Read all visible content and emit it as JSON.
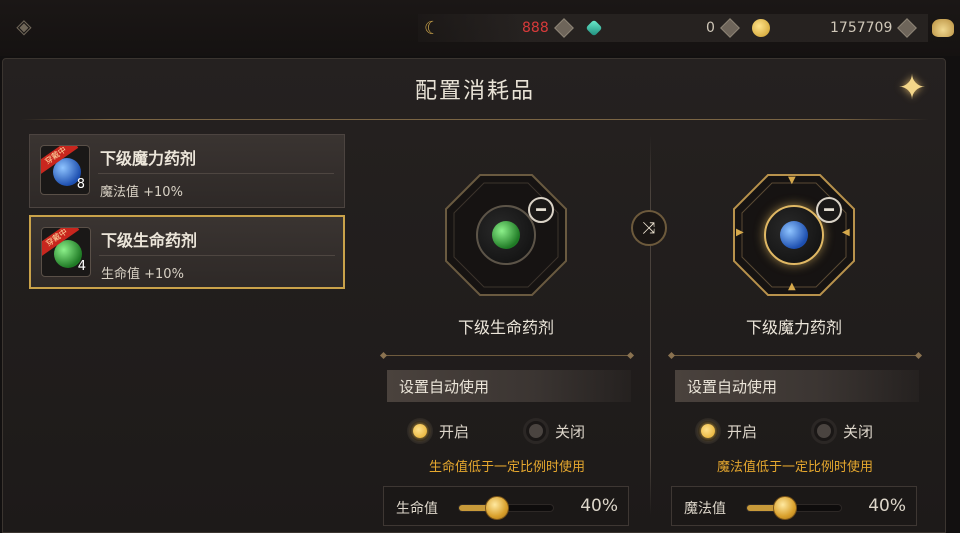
{
  "topbar": {
    "back_icon": "back-arrow-icon",
    "resources": [
      {
        "icon": "crescent-icon",
        "value": ""
      },
      {
        "icon": "red-gem-icon",
        "value": "888"
      },
      {
        "icon": "teal-crystal-icon",
        "value": "0"
      },
      {
        "icon": "gold-coin-icon",
        "value": "1757709"
      },
      {
        "icon": "bag-icon",
        "value": ""
      }
    ]
  },
  "panel": {
    "title": "配置消耗品",
    "close_icon": "close-star-icon"
  },
  "consumables": [
    {
      "name": "下级魔力药剂",
      "desc": "魔法值 +10%",
      "qty": "8",
      "badge": "穿戴中",
      "color": "#2f6fd6",
      "selected": false
    },
    {
      "name": "下级生命药剂",
      "desc": "生命值 +10%",
      "qty": "4",
      "badge": "穿戴中",
      "color": "#2fa03a",
      "selected": true
    }
  ],
  "slots": [
    {
      "name": "下级生命药剂",
      "color": "#2fa03a",
      "auto_title": "设置自动使用",
      "on_label": "开启",
      "off_label": "关闭",
      "enabled": true,
      "hint": "生命值低于一定比例时使用",
      "slider_label": "生命值",
      "percent_text": "40%",
      "percent_value": 0.4
    },
    {
      "name": "下级魔力药剂",
      "color": "#2f6fd6",
      "auto_title": "设置自动使用",
      "on_label": "开启",
      "off_label": "关闭",
      "enabled": true,
      "hint": "魔法值低于一定比例时使用",
      "slider_label": "魔法值",
      "percent_text": "40%",
      "percent_value": 0.4
    }
  ],
  "colors": {
    "accent_gold": "#c9a24a",
    "hint_orange": "#e5a72e"
  }
}
